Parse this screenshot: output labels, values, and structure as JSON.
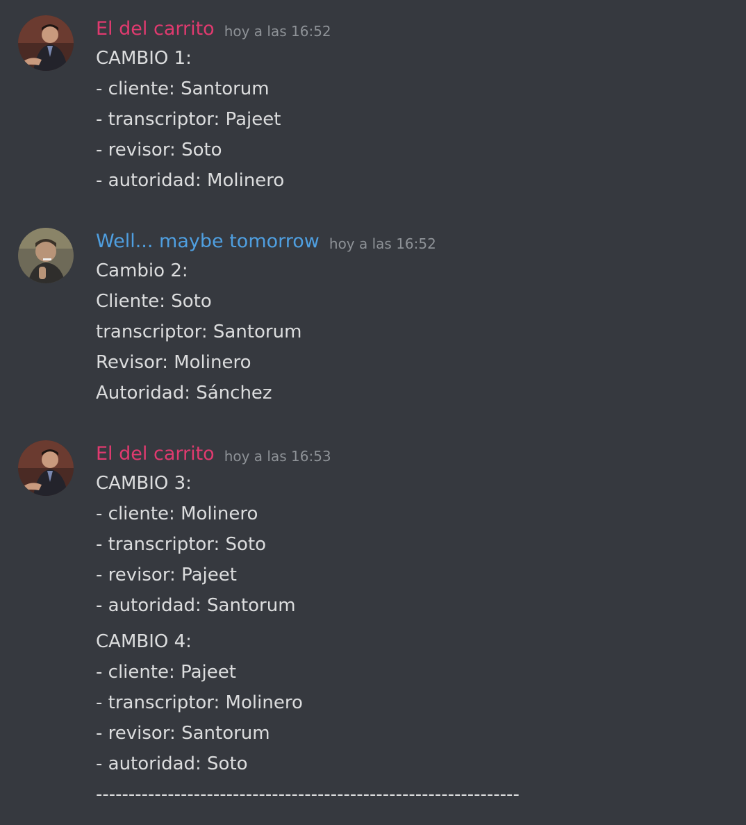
{
  "messages": [
    {
      "author": "El del carrito",
      "author_color": "#e03a6f",
      "timestamp": "hoy a las 16:52",
      "avatar_icon": "user-avatar-man-suit",
      "blocks": [
        [
          "CAMBIO 1:",
          "- cliente: Santorum",
          "- transcriptor: Pajeet",
          "- revisor: Soto",
          "- autoridad: Molinero"
        ]
      ]
    },
    {
      "author": "Well... maybe tomorrow",
      "author_color": "#4f9fe0",
      "timestamp": "hoy a las 16:52",
      "avatar_icon": "user-avatar-man-smoking",
      "blocks": [
        [
          "Cambio 2:",
          "Cliente: Soto",
          "transcriptor: Santorum",
          "Revisor: Molinero",
          "Autoridad: Sánchez"
        ]
      ]
    },
    {
      "author": "El del carrito",
      "author_color": "#e03a6f",
      "timestamp": "hoy a las 16:53",
      "avatar_icon": "user-avatar-man-suit",
      "blocks": [
        [
          "CAMBIO 3:",
          "- cliente: Molinero",
          "- transcriptor: Soto",
          "- revisor: Pajeet",
          "- autoridad: Santorum"
        ],
        [
          "CAMBIO 4:",
          "- cliente: Pajeet",
          "- transcriptor: Molinero",
          "- revisor: Santorum",
          "- autoridad: Soto"
        ]
      ],
      "separator": "-----------------------------------------------------------------"
    }
  ]
}
